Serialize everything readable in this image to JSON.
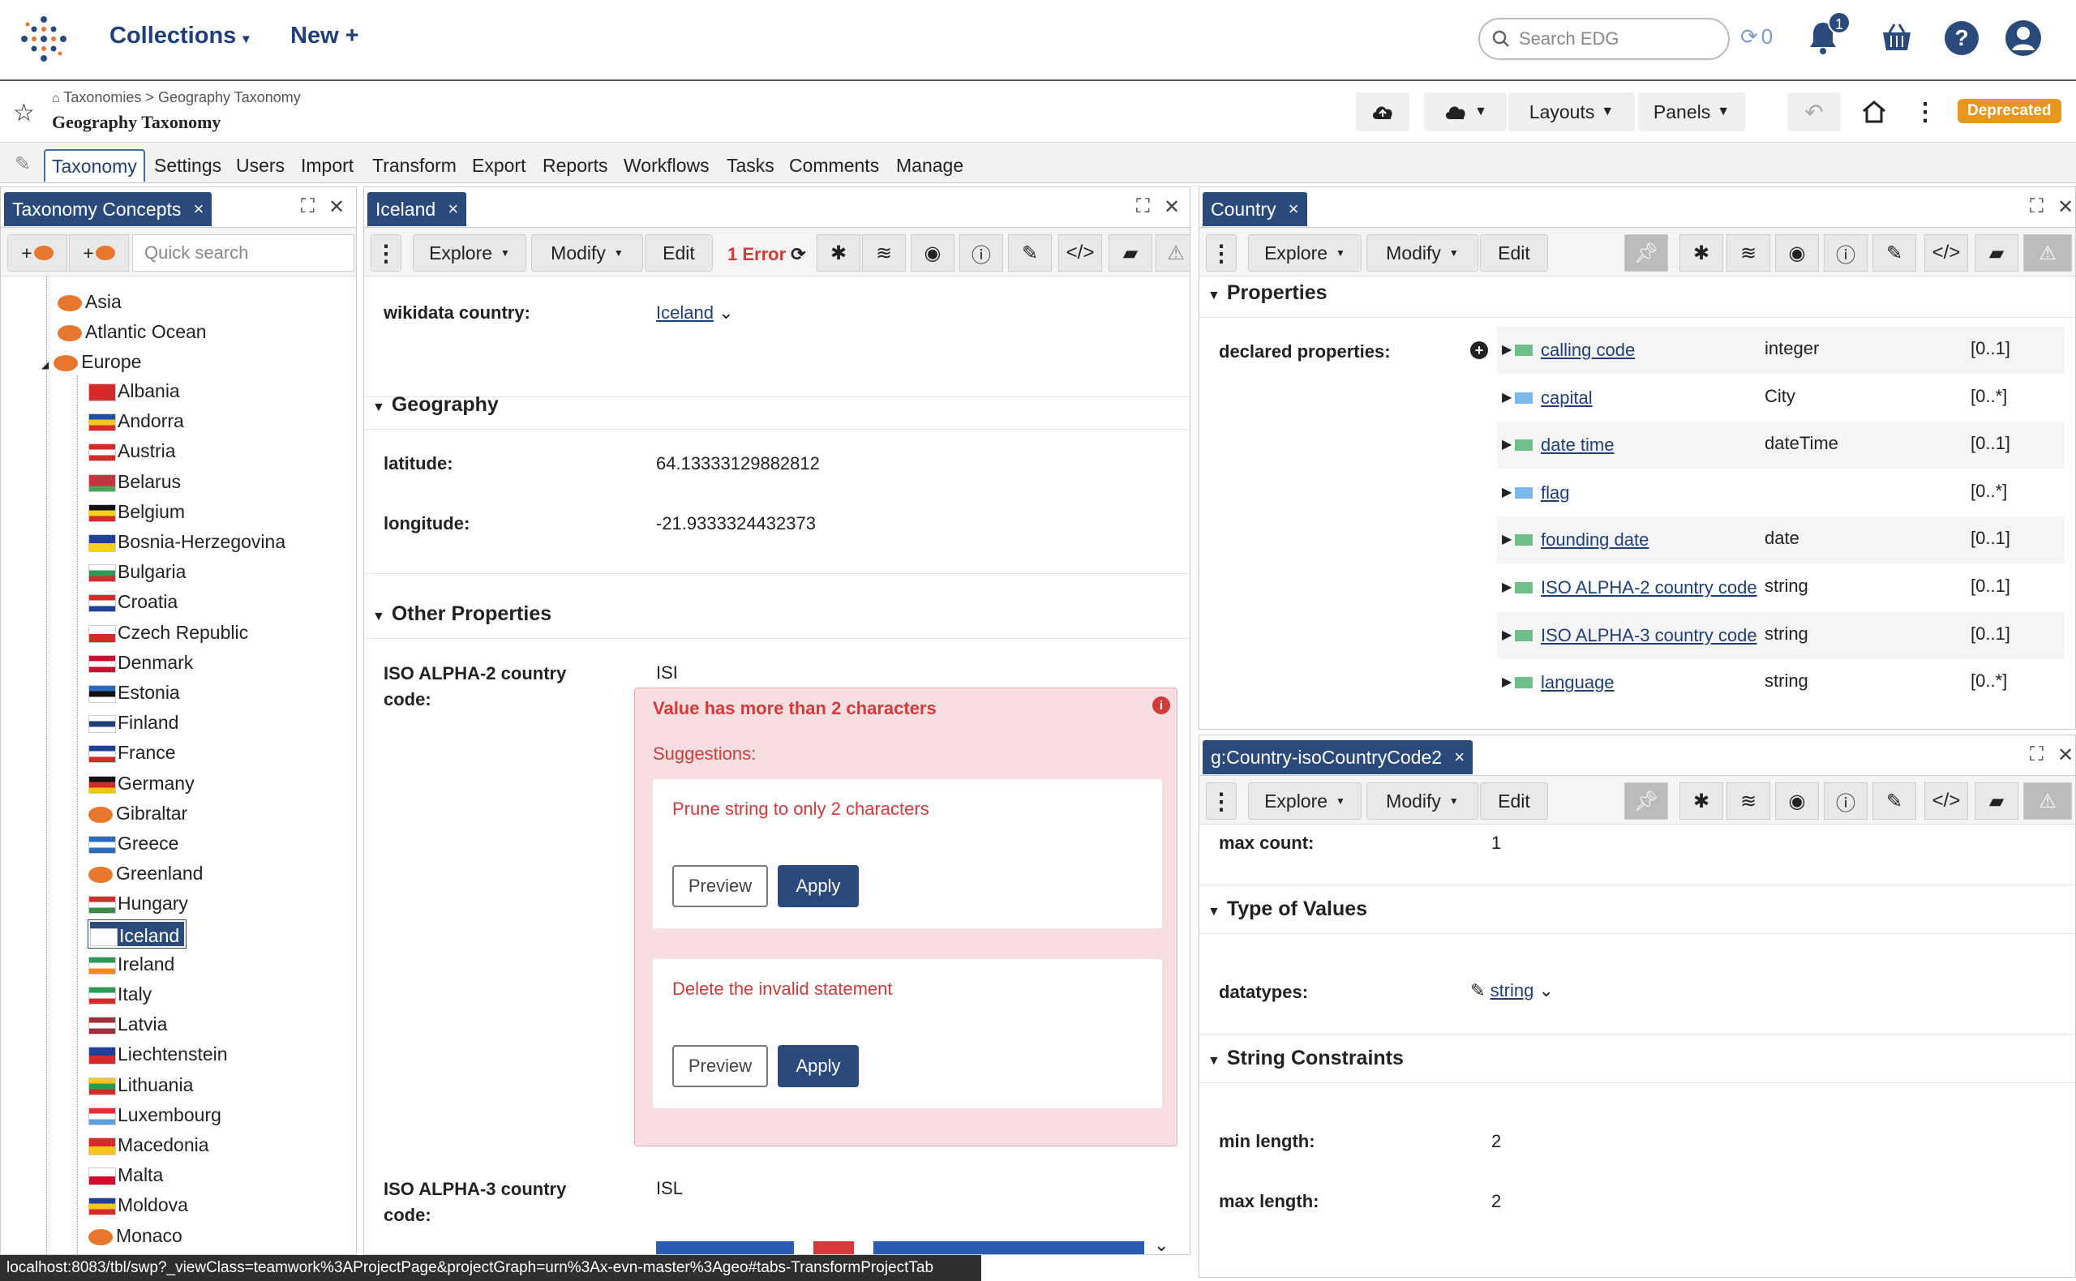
{
  "topbar": {
    "collections_label": "Collections",
    "new_label": "New +",
    "search_placeholder": "Search EDG",
    "sync_count": "0",
    "notification_count": "1"
  },
  "project": {
    "breadcrumb_root": "Taxonomies",
    "breadcrumb_sep": ">",
    "breadcrumb_current": "Geography Taxonomy",
    "title": "Geography Taxonomy",
    "layouts_label": "Layouts",
    "panels_label": "Panels",
    "status_badge": "Deprecated"
  },
  "menu": {
    "items": [
      "Taxonomy",
      "Settings",
      "Users",
      "Import",
      "Transform",
      "Export",
      "Reports",
      "Workflows",
      "Tasks",
      "Comments",
      "Manage"
    ]
  },
  "left_panel": {
    "tab_title": "Taxonomy Concepts",
    "quick_search_placeholder": "Quick search",
    "add_child_label": "+",
    "add_sibling_label": "+",
    "tree_top": [
      "Asia",
      "Atlantic Ocean",
      "Europe"
    ],
    "countries": [
      "Albania",
      "Andorra",
      "Austria",
      "Belarus",
      "Belgium",
      "Bosnia-Herzegovina",
      "Bulgaria",
      "Croatia",
      "Czech Republic",
      "Denmark",
      "Estonia",
      "Finland",
      "France",
      "Germany",
      "Gibraltar",
      "Greece",
      "Greenland",
      "Hungary",
      "Iceland",
      "Ireland",
      "Italy",
      "Latvia",
      "Liechtenstein",
      "Lithuania",
      "Luxembourg",
      "Macedonia",
      "Malta",
      "Moldova",
      "Monaco"
    ],
    "selected": "Iceland"
  },
  "center_panel": {
    "tab_title": "Iceland",
    "explore_label": "Explore",
    "modify_label": "Modify",
    "edit_label": "Edit",
    "error_label": "1 Error",
    "wikidata_label": "wikidata country:",
    "wikidata_value": "Iceland",
    "geography_header": "Geography",
    "latitude_label": "latitude:",
    "latitude_value": "64.13333129882812",
    "longitude_label": "longitude:",
    "longitude_value": "-21.9333324432373",
    "other_header": "Other Properties",
    "iso2_label_1": "ISO ALPHA-2 country",
    "iso2_label_2": "code:",
    "iso2_value": "ISI",
    "error_message": "Value has more than 2 characters",
    "suggestions_label": "Suggestions:",
    "suggestion1": "Prune string to only 2 characters",
    "suggestion2": "Delete the invalid statement",
    "preview_label": "Preview",
    "apply_label": "Apply",
    "iso3_label_1": "ISO ALPHA-3 country",
    "iso3_label_2": "code:",
    "iso3_value": "ISL"
  },
  "right_top_panel": {
    "tab_title": "Country",
    "explore_label": "Explore",
    "modify_label": "Modify",
    "edit_label": "Edit",
    "properties_header": "Properties",
    "declared_label": "declared properties:",
    "rows": [
      {
        "name": "calling code",
        "type": "integer",
        "card": "[0..1]",
        "kind": "datatype"
      },
      {
        "name": "capital",
        "type": "City",
        "card": "[0..*]",
        "kind": "object"
      },
      {
        "name": "date time",
        "type": "dateTime",
        "card": "[0..1]",
        "kind": "datatype"
      },
      {
        "name": "flag",
        "type": "",
        "card": "[0..*]",
        "kind": "object"
      },
      {
        "name": "founding date",
        "type": "date",
        "card": "[0..1]",
        "kind": "datatype"
      },
      {
        "name": "ISO ALPHA-2 country code",
        "type": "string",
        "card": "[0..1]",
        "kind": "datatype"
      },
      {
        "name": "ISO ALPHA-3 country code",
        "type": "string",
        "card": "[0..1]",
        "kind": "datatype"
      },
      {
        "name": "language",
        "type": "string",
        "card": "[0..*]",
        "kind": "datatype"
      }
    ]
  },
  "right_bottom_panel": {
    "tab_title": "g:Country-isoCountryCode2",
    "explore_label": "Explore",
    "modify_label": "Modify",
    "edit_label": "Edit",
    "max_count_label": "max count:",
    "max_count_value": "1",
    "type_header": "Type of Values",
    "datatypes_label": "datatypes:",
    "datatypes_value": "string",
    "string_header": "String Constraints",
    "min_length_label": "min length:",
    "min_length_value": "2",
    "max_length_label": "max length:",
    "max_length_value": "2"
  },
  "statusbar": {
    "url": "localhost:8083/tbl/swp?_viewClass=teamwork%3AProjectPage&projectGraph=urn%3Ax-evn-master%3Ageo#tabs-TransformProjectTab"
  },
  "colors": {
    "accent": "#2b4a7c",
    "link": "#1f3f7a",
    "error": "#d33a3a",
    "deprecated": "#e8961e"
  }
}
